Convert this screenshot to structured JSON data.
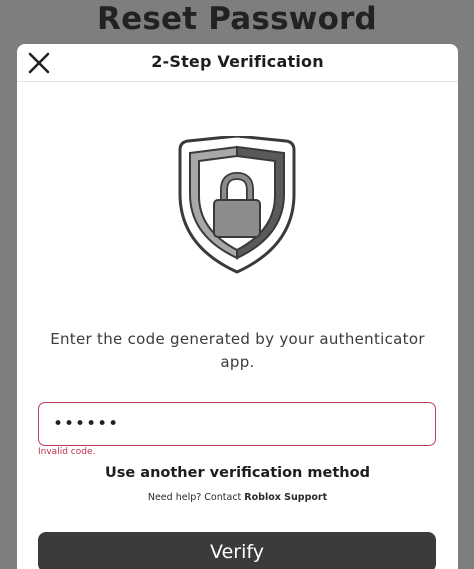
{
  "background": {
    "title": "Reset Password"
  },
  "modal": {
    "title": "2-Step Verification",
    "close_icon": "close-icon",
    "shield_icon": "shield-lock-icon",
    "instruction": "Enter the code generated by your authenticator app.",
    "code_input": {
      "value": "••••••",
      "state": "invalid"
    },
    "error_message": "Invalid code.",
    "alt_method_label": "Use another verification method",
    "help_prefix": "Need help? Contact",
    "help_link": "Roblox Support",
    "verify_label": "Verify"
  },
  "colors": {
    "overlay": "#7e7e7e",
    "error": "#c0304a",
    "button": "#393b3d"
  }
}
